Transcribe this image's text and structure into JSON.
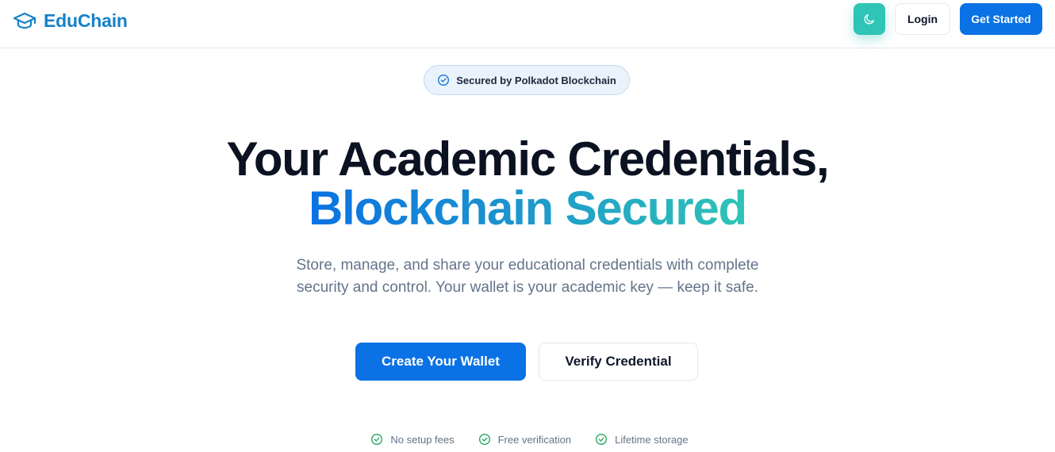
{
  "brand": {
    "name": "EduChain",
    "icon": "graduation-cap-icon"
  },
  "nav": {
    "theme_toggle_icon": "moon-icon",
    "login_label": "Login",
    "get_started_label": "Get Started"
  },
  "badge": {
    "icon": "check-circle-icon",
    "text": "Secured by Polkadot Blockchain"
  },
  "hero": {
    "headline_line1": "Your Academic Credentials,",
    "headline_line2": "Blockchain Secured",
    "subtitle_line1": "Store, manage, and share your educational credentials with complete",
    "subtitle_line2": "security and control. Your wallet is your academic key — keep it safe.",
    "primary_cta": "Create Your Wallet",
    "secondary_cta": "Verify Credential"
  },
  "features": [
    {
      "icon": "check-circle-icon",
      "label": "No setup fees"
    },
    {
      "icon": "check-circle-icon",
      "label": "Free verification"
    },
    {
      "icon": "check-circle-icon",
      "label": "Lifetime storage"
    }
  ],
  "colors": {
    "primary": "#0a72e4",
    "accent_teal": "#2ec4b6",
    "brand_text": "#1681c9",
    "feature_check": "#22a35a"
  }
}
